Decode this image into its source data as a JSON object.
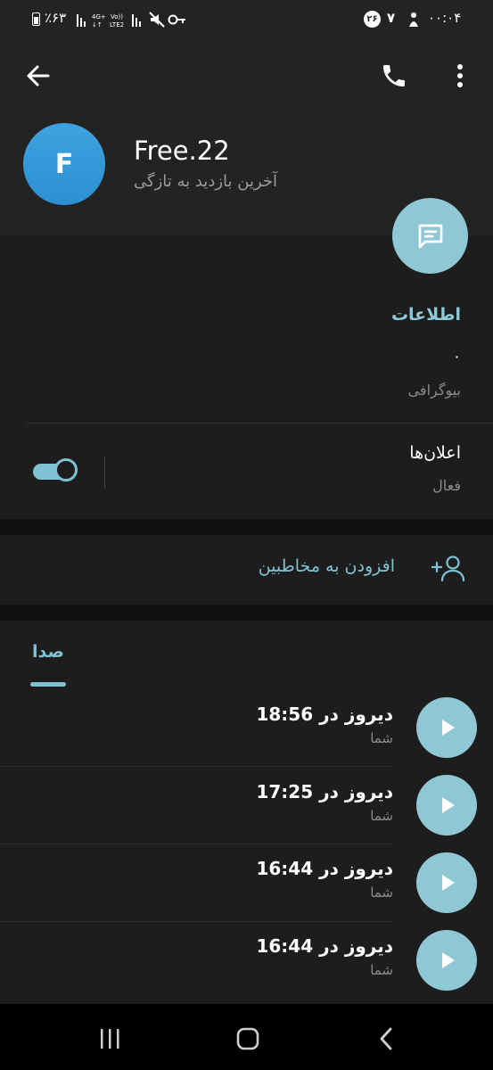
{
  "status_bar": {
    "left_text": "٪۶۳",
    "right_time": "۰۰:۰۴",
    "notif_badge": "۲۶",
    "notif_seven": "۷"
  },
  "header": {
    "avatar_letter": "F",
    "name": "Free.22",
    "last_seen": "آخرین بازدید به تازگی"
  },
  "info": {
    "title": "اطلاعات",
    "bio_value": "۰",
    "bio_label": "بیوگرافی",
    "notifications_title": "اعلان‌ها",
    "notifications_sub": "فعال"
  },
  "add_contact": {
    "label": "افزودن به مخاطبین"
  },
  "tabs": {
    "voice": "صدا"
  },
  "voice_items": [
    {
      "title": "دیروز در 18:56",
      "sub": "شما"
    },
    {
      "title": "دیروز در 17:25",
      "sub": "شما"
    },
    {
      "title": "دیروز در 16:44",
      "sub": "شما"
    },
    {
      "title": "دیروز در 16:44",
      "sub": "شما"
    }
  ],
  "colors": {
    "accent": "#7ec2d4",
    "avatar_blue": "#3ea3e0",
    "background": "#1d1d1d",
    "header_bg": "#232323"
  }
}
